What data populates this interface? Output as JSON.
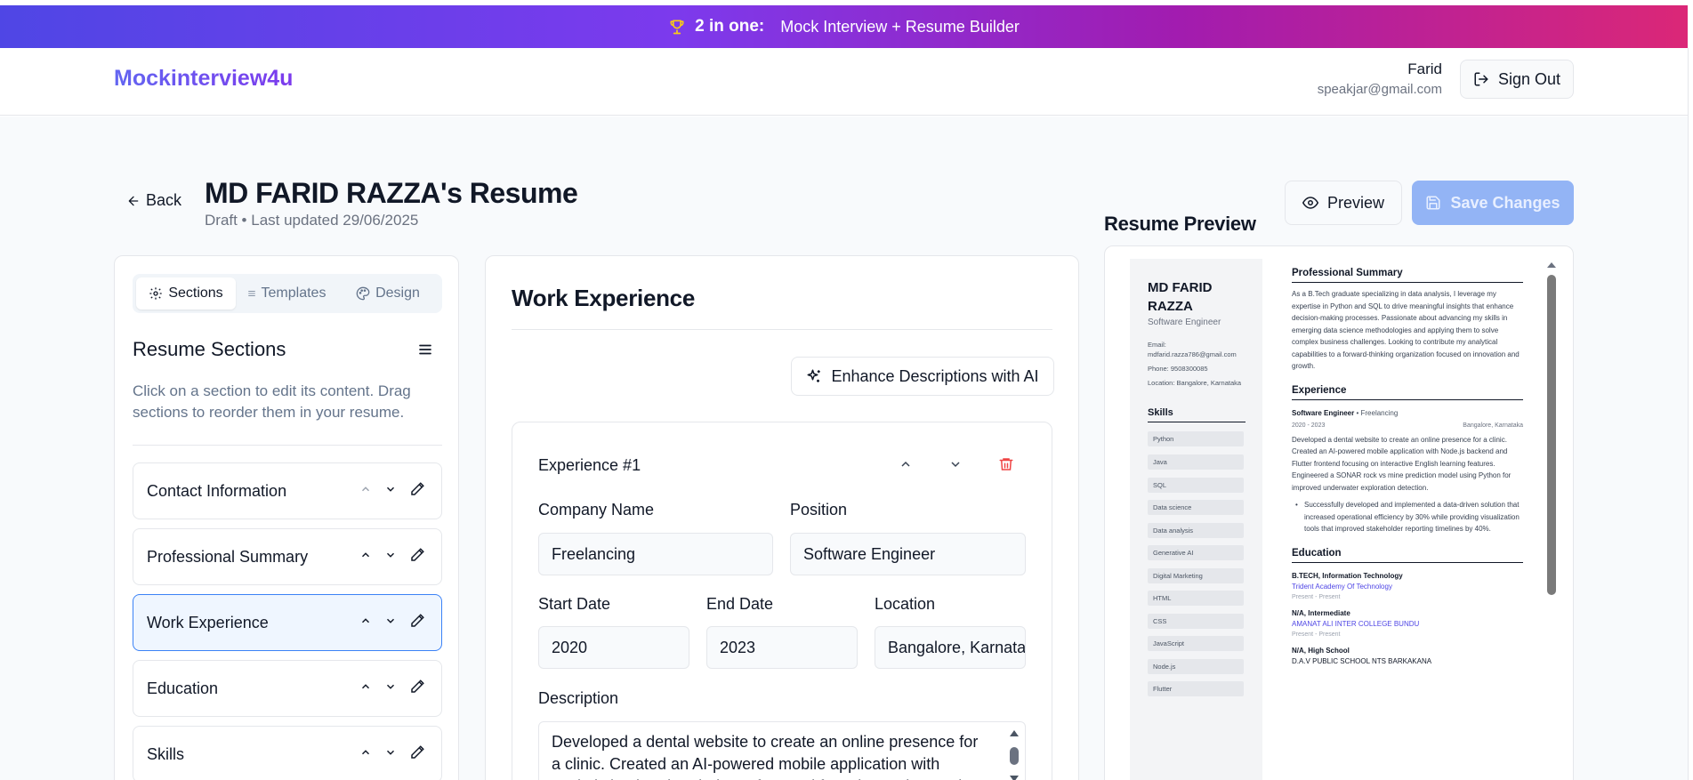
{
  "banner": {
    "highlight": "2 in one:",
    "text": "Mock Interview + Resume Builder"
  },
  "header": {
    "logo": "Mockinterview4u",
    "user_name": "Farid",
    "user_email": "speakjar@gmail.com",
    "signout_label": "Sign Out"
  },
  "page": {
    "back_label": "Back",
    "title": "MD FARID RAZZA's Resume",
    "subtitle": "Draft • Last updated 29/06/2025",
    "preview_label": "Preview",
    "save_label": "Save Changes"
  },
  "sidebar": {
    "tabs": [
      {
        "label": "Sections",
        "icon": "gear-icon"
      },
      {
        "label": "Templates",
        "icon": "template-icon"
      },
      {
        "label": "Design",
        "icon": "palette-icon"
      }
    ],
    "title": "Resume Sections",
    "description": "Click on a section to edit its content. Drag sections to reorder them in your resume.",
    "items": [
      {
        "label": "Contact Information"
      },
      {
        "label": "Professional Summary"
      },
      {
        "label": "Work Experience"
      },
      {
        "label": "Education"
      },
      {
        "label": "Skills"
      }
    ],
    "active_item": "Work Experience"
  },
  "editor": {
    "section_title": "Work Experience",
    "enhance_label": "Enhance Descriptions with AI",
    "experience": {
      "title": "Experience #1",
      "company_label": "Company Name",
      "company_value": "Freelancing",
      "position_label": "Position",
      "position_value": "Software Engineer",
      "start_label": "Start Date",
      "start_value": "2020",
      "end_label": "End Date",
      "end_value": "2023",
      "location_label": "Location",
      "location_value": "Bangalore, Karnataka",
      "description_label": "Description",
      "description_value": "Developed a dental website to create an online presence for a clinic. Created an AI-powered mobile application with Node.js backend and Flutter frontend focusing on interactive English"
    }
  },
  "preview": {
    "title": "Resume Preview",
    "name": "MD FARID RAZZA",
    "role": "Software Engineer",
    "email_label": "Email:",
    "email": "mdfarid.razza786@gmail.com",
    "phone": "Phone: 9508300085",
    "location": "Location: Bangalore, Karnataka",
    "skills_title": "Skills",
    "skills": [
      "Python",
      "Java",
      "SQL",
      "Data science",
      "Data analysis",
      "Generative AI",
      "Digital Marketing",
      "HTML",
      "CSS",
      "JavaScript",
      "Node.js",
      "Flutter"
    ],
    "summary_title": "Professional Summary",
    "summary": "As a B.Tech graduate specializing in data analysis, I leverage my expertise in Python and SQL to drive meaningful insights that enhance decision-making processes. Passionate about advancing my skills in emerging data science methodologies and applying them to solve complex business challenges. Looking to contribute my analytical capabilities to a forward-thinking organization focused on innovation and growth.",
    "experience_title": "Experience",
    "job_title": "Software Engineer",
    "job_company": " • Freelancing",
    "job_dates": "2020 - 2023",
    "job_location": "Bangalore, Karnataka",
    "job_desc": "Developed a dental website to create an online presence for a clinic. Created an AI-powered mobile application with Node.js backend and Flutter frontend focusing on interactive English learning features. Engineered a SONAR rock vs mine prediction model using Python for improved underwater exploration detection.",
    "job_bullet": "Successfully developed and implemented a data-driven solution that increased operational efficiency by 30% while providing visualization tools that improved stakeholder reporting timelines by 40%.",
    "education_title": "Education",
    "edu": [
      {
        "degree": "B.TECH, Information Technology",
        "school": "Trident Academy Of Technology",
        "dates": "Present - Present"
      },
      {
        "degree": "N/A, Intermediate",
        "school": "AMANAT ALI INTER COLLEGE BUNDU",
        "dates": "Present - Present"
      },
      {
        "degree": "N/A, High School",
        "school": "D.A.V PUBLIC SCHOOL NTS BARKAKANA",
        "dates": ""
      }
    ]
  },
  "colors": {
    "accent": "#3b82f6",
    "brand_start": "#4f46e5",
    "brand_end": "#db2777",
    "delete": "#ef4444"
  }
}
